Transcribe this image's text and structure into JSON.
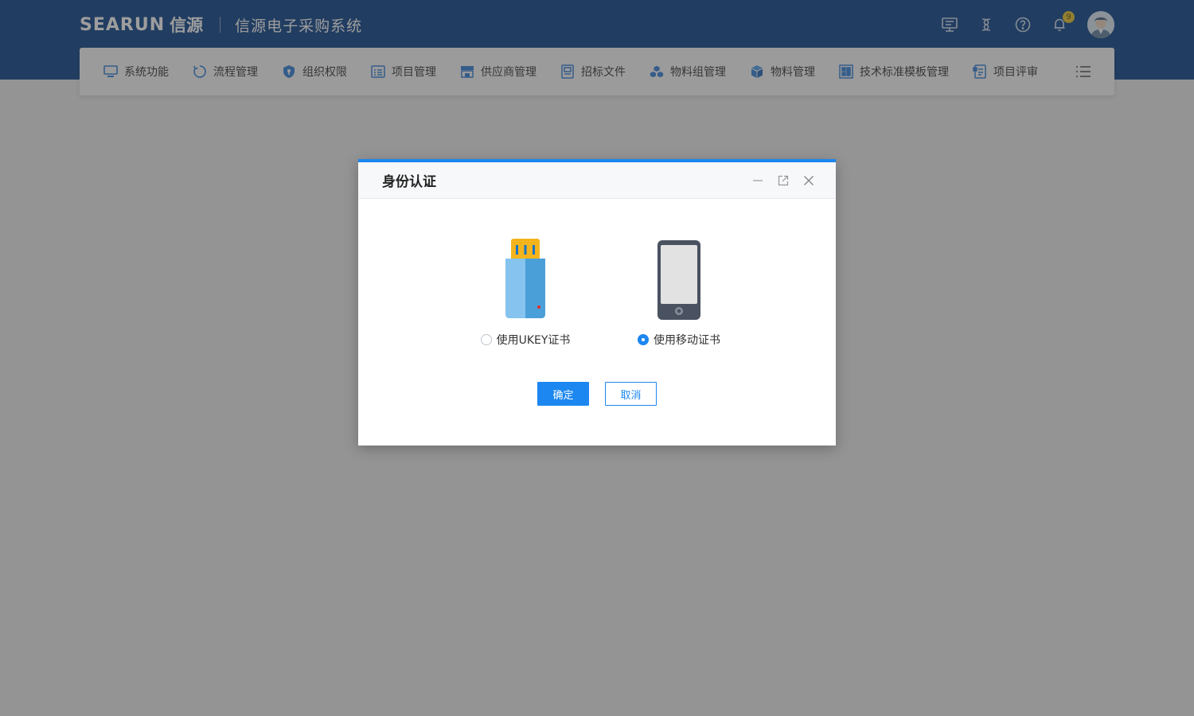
{
  "header": {
    "logo_en": "SEARUN",
    "logo_cn": "信源",
    "system_title": "信源电子采购系统",
    "notification_count": "9",
    "brand_color": "#073f86",
    "tools": [
      "monitor-icon",
      "link-icon",
      "help-icon",
      "bell-icon",
      "user-avatar"
    ]
  },
  "nav": {
    "items": [
      {
        "label": "系统功能",
        "icon": "monitor-icon"
      },
      {
        "label": "流程管理",
        "icon": "cycle-icon"
      },
      {
        "label": "组织权限",
        "icon": "shield-icon"
      },
      {
        "label": "项目管理",
        "icon": "list-icon"
      },
      {
        "label": "供应商管理",
        "icon": "store-icon"
      },
      {
        "label": "招标文件",
        "icon": "document-icon"
      },
      {
        "label": "物料组管理",
        "icon": "cubes-icon"
      },
      {
        "label": "物料管理",
        "icon": "cube-icon"
      },
      {
        "label": "技术标准模板管理",
        "icon": "template-icon"
      },
      {
        "label": "项目评审",
        "icon": "review-icon"
      }
    ],
    "more_icon": "menu-icon"
  },
  "dialog": {
    "title": "身份认证",
    "accent_color": "#1c87f0",
    "controls": [
      "minimize-icon",
      "popout-icon",
      "close-icon"
    ],
    "options": [
      {
        "label": "使用UKEY证书",
        "checked": false,
        "icon": "usb-key-icon"
      },
      {
        "label": "使用移动证书",
        "checked": true,
        "icon": "mobile-phone-icon"
      }
    ],
    "confirm_label": "确定",
    "cancel_label": "取消"
  }
}
